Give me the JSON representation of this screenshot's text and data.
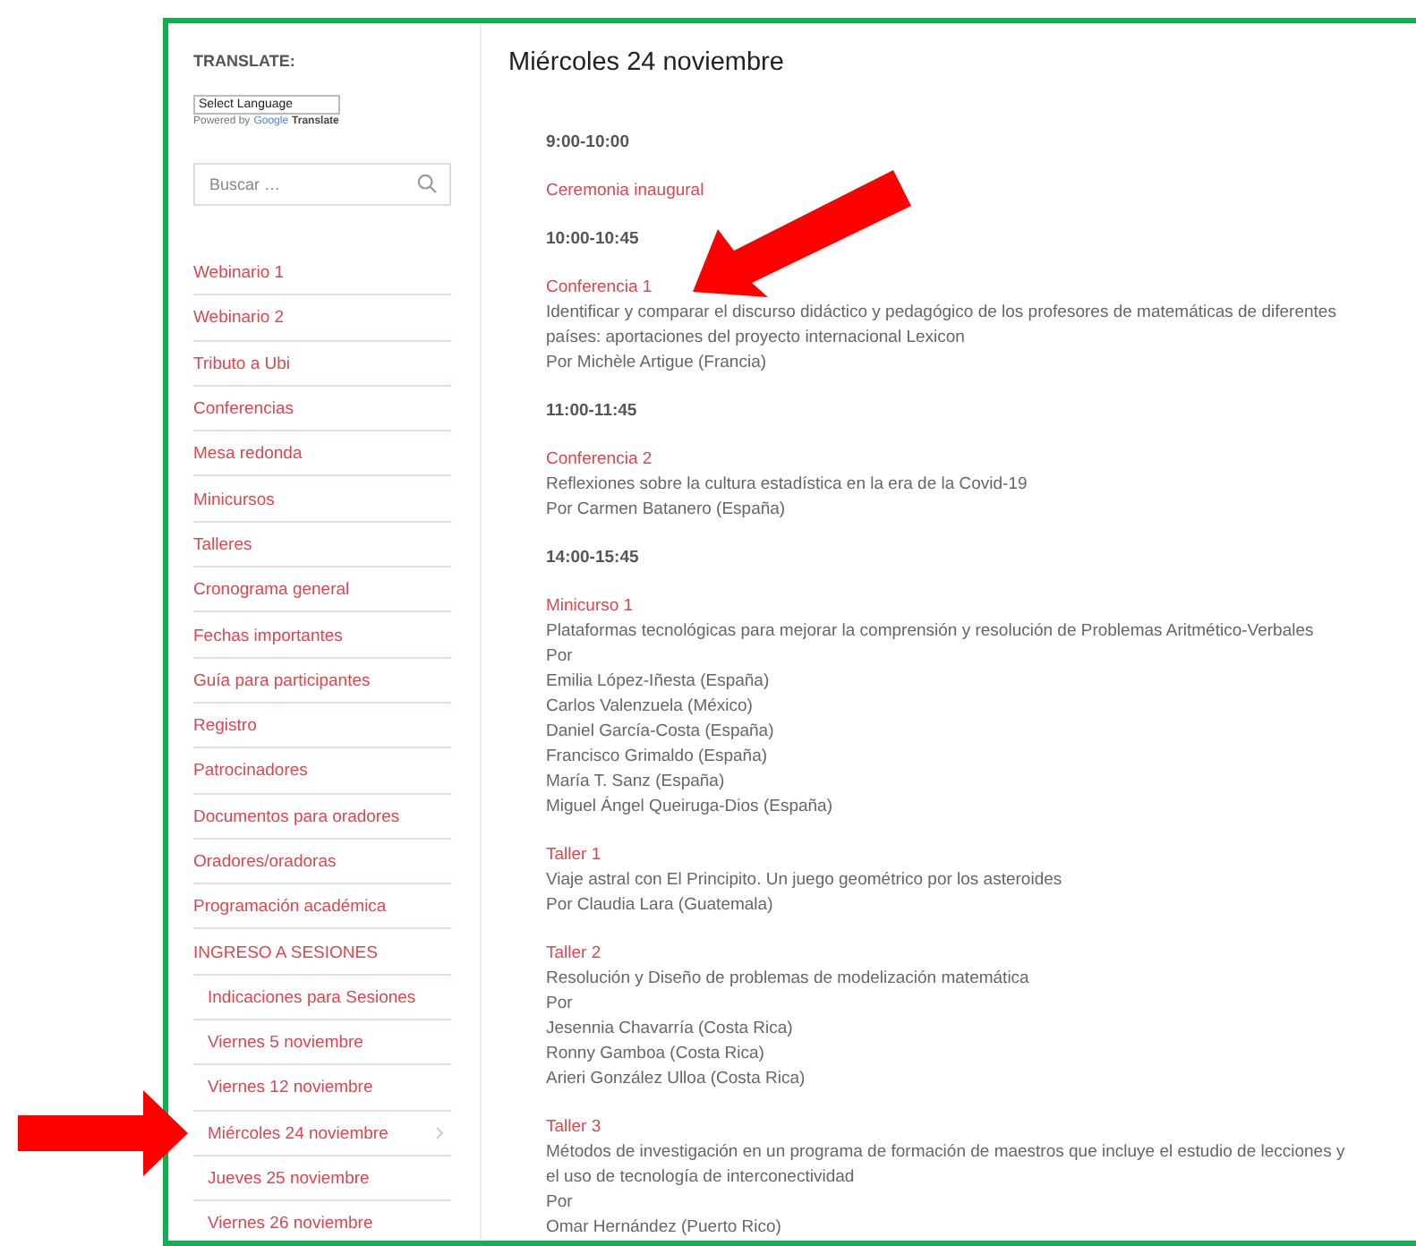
{
  "sidebar": {
    "translate_heading": "TRANSLATE:",
    "language_select": "Select Language",
    "powered_by": "Powered by",
    "google": "Google",
    "translate": "Translate",
    "search": {
      "placeholder": "Buscar …"
    },
    "menu": [
      {
        "label": "Webinario 1",
        "expandable": false
      },
      {
        "label": "Webinario 2",
        "expandable": false
      },
      {
        "label": "Tributo a Ubi",
        "expandable": false
      },
      {
        "label": "Conferencias",
        "expandable": false
      },
      {
        "label": "Mesa redonda",
        "expandable": false
      },
      {
        "label": "Minicursos",
        "expandable": false
      },
      {
        "label": "Talleres",
        "expandable": false
      },
      {
        "label": "Cronograma general",
        "expandable": false
      },
      {
        "label": "Fechas importantes",
        "expandable": false
      },
      {
        "label": "Guía para participantes",
        "expandable": false
      },
      {
        "label": "Registro",
        "expandable": false
      },
      {
        "label": "Patrocinadores",
        "expandable": false
      },
      {
        "label": "Documentos para oradores",
        "expandable": false
      },
      {
        "label": "Oradores/oradoras",
        "expandable": false
      },
      {
        "label": "Programación académica",
        "expandable": false
      },
      {
        "label": "INGRESO A SESIONES",
        "expandable": false,
        "children": [
          {
            "label": "Indicaciones para Sesiones",
            "expandable": false
          },
          {
            "label": "Viernes 5 noviembre",
            "expandable": false
          },
          {
            "label": "Viernes 12 noviembre",
            "expandable": false
          },
          {
            "label": "Miércoles 24 noviembre",
            "expandable": true
          },
          {
            "label": "Jueves 25 noviembre",
            "expandable": false
          },
          {
            "label": "Viernes 26 noviembre",
            "expandable": false
          }
        ]
      }
    ]
  },
  "main": {
    "title": "Miércoles 24 noviembre",
    "blocks": [
      {
        "kind": "time",
        "text": "9:00-10:00"
      },
      {
        "kind": "event",
        "title": "Ceremonia inaugural"
      },
      {
        "kind": "time",
        "text": "10:00-10:45"
      },
      {
        "kind": "event",
        "title": "Conferencia 1",
        "lines": [
          "Identificar y comparar el discurso didáctico y pedagógico de los profesores de matemáticas de diferentes países: aportaciones del proyecto internacional Lexicon",
          "Por Michèle Artigue (Francia)"
        ]
      },
      {
        "kind": "time",
        "text": "11:00-11:45"
      },
      {
        "kind": "event",
        "title": "Conferencia 2",
        "lines": [
          "Reflexiones sobre la cultura estadística en la era de la Covid-19",
          "Por Carmen Batanero (España)"
        ]
      },
      {
        "kind": "time",
        "text": "14:00-15:45"
      },
      {
        "kind": "event",
        "title": "Minicurso 1",
        "lines": [
          "Plataformas tecnológicas para mejorar la comprensión y resolución de Problemas Aritmético-Verbales",
          "Por",
          "Emilia López-Iñesta (España)",
          "Carlos Valenzuela (México)",
          "Daniel García-Costa (España)",
          "Francisco Grimaldo (España)",
          "María T. Sanz (España)",
          "Miguel Ángel Queiruga-Dios (España)"
        ]
      },
      {
        "kind": "event",
        "title": "Taller 1",
        "lines": [
          "Viaje astral con El Principito. Un juego geométrico por los asteroides",
          "Por Claudia Lara (Guatemala)"
        ]
      },
      {
        "kind": "event",
        "title": "Taller 2",
        "lines": [
          "Resolución y Diseño de problemas de modelización matemática",
          "Por",
          "Jesennia Chavarría (Costa Rica)",
          "Ronny Gamboa (Costa Rica)",
          "Arieri González Ulloa (Costa Rica)"
        ]
      },
      {
        "kind": "event",
        "title": "Taller 3",
        "lines": [
          "Métodos de investigación en un programa de formación de maestros que incluye el estudio de lecciones y el uso de tecnología de interconectividad",
          "Por",
          "Omar Hernández (Puerto Rico)"
        ]
      }
    ]
  }
}
